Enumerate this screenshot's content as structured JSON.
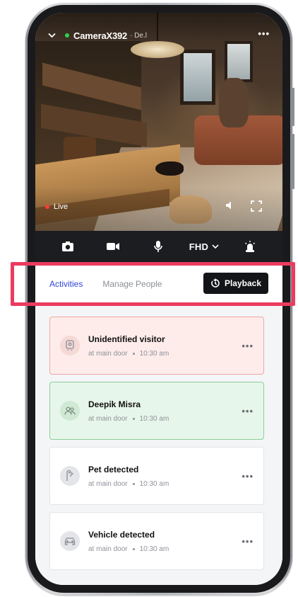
{
  "camera": {
    "name": "CameraX392",
    "subtitle": "· De.l",
    "status_color": "#2dd24e",
    "live_label": "Live",
    "quality": "FHD"
  },
  "controls": {
    "items": [
      "camera-icon",
      "video-icon",
      "mic-icon",
      "fhd-quality-select",
      "siren-icon"
    ]
  },
  "tabs": {
    "activities": "Activities",
    "manage_people": "Manage People",
    "playback": "Playback"
  },
  "events": [
    {
      "title": "Unidentified visitor",
      "location": "at main door",
      "time": "10:30 am",
      "icon": "visitor-icon",
      "status": "alert"
    },
    {
      "title": "Deepik Misra",
      "location": "at main door",
      "time": "10:30 am",
      "icon": "people-icon",
      "status": "known"
    },
    {
      "title": "Pet detected",
      "location": "at main door",
      "time": "10:30 am",
      "icon": "pet-icon",
      "status": "neutral"
    },
    {
      "title": "Vehicle detected",
      "location": "at main door",
      "time": "10:30 am",
      "icon": "car-icon",
      "status": "neutral"
    }
  ],
  "colors": {
    "accent": "#2f45d6",
    "highlight_border": "#ec3b5f",
    "alert_bg": "#fdecea",
    "alert_border": "#f0a8a4",
    "known_bg": "#e7f6ea",
    "known_border": "#8ccf98",
    "live_dot": "#ff3b3b"
  }
}
